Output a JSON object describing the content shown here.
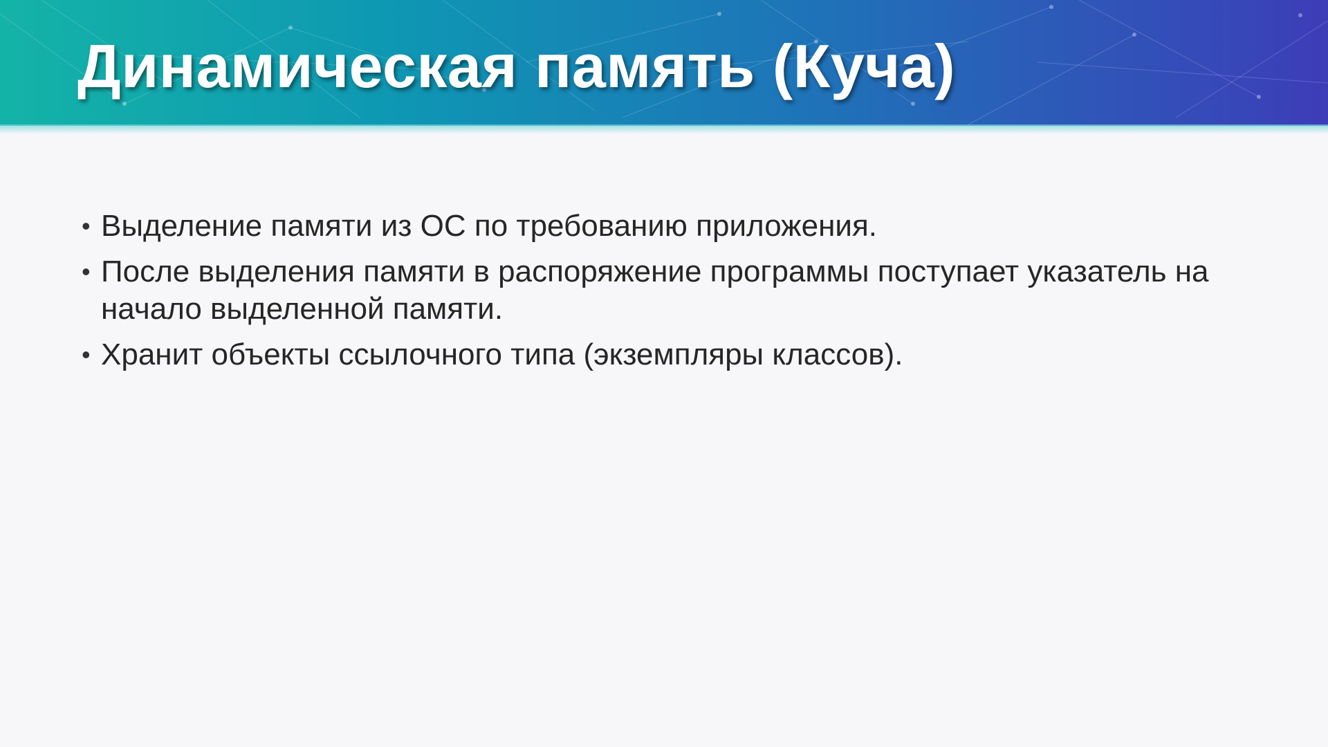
{
  "slide": {
    "title": "Динамическая память (Куча)",
    "bullet_glyph": "•",
    "bullets": [
      "Выделение памяти из ОС по требованию приложения.",
      "После выделения памяти в распоряжение программы поступает указатель на начало выделенной памяти.",
      "Хранит объекты ссылочного типа (экземпляры классов)."
    ]
  },
  "colors": {
    "header_gradient_start": "#14b3a7",
    "header_gradient_end": "#3d3db8",
    "background": "#f7f7f9",
    "title_text": "#ffffff",
    "body_text": "#262626"
  }
}
